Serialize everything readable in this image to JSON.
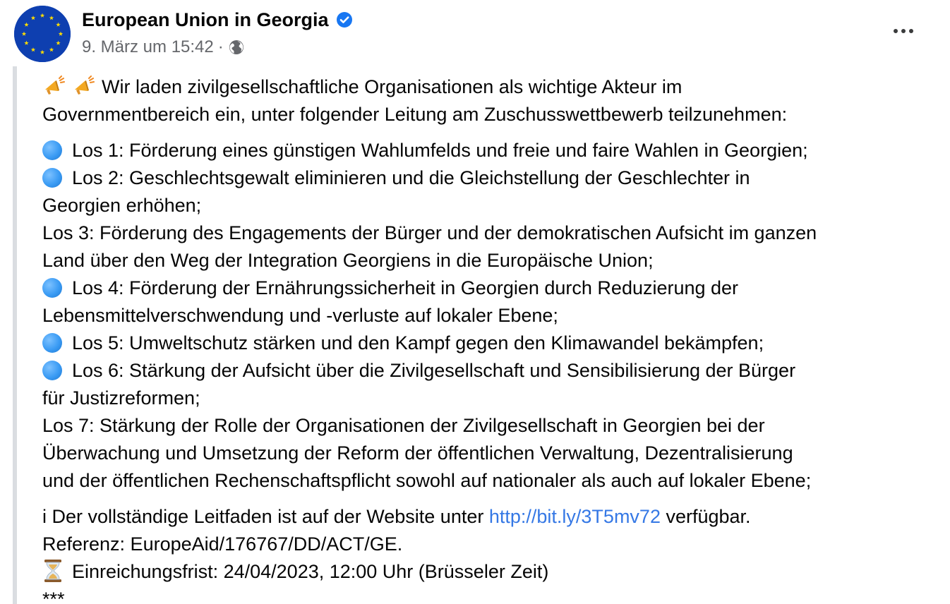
{
  "post": {
    "author": "European Union in Georgia",
    "timestamp": "9. März um 15:42",
    "separator": "·",
    "verified": true,
    "privacy_icon": "globe-icon",
    "more_icon": "more-options-icon",
    "colors": {
      "eu_blue": "#0e3fb0",
      "eu_star": "#ffdd00",
      "verified": "#1877f2",
      "link": "#3578e5",
      "meta_text": "#65676b",
      "quote_bar": "#dadde1"
    }
  },
  "body": {
    "intro": [
      "Wir laden zivilgesellschaftliche Organisationen als wichtige Akteur im",
      "Governmentbereich ein, unter folgender Leitung am Zuschusswettbewerb teilzunehmen:"
    ],
    "lots": {
      "los1": "Los 1: Förderung eines günstigen Wahlumfelds und freie und faire Wahlen in Georgien;",
      "los2_a": "Los 2: Geschlechtsgewalt eliminieren und die Gleichstellung der Geschlechter in",
      "los2_b": "Georgien erhöhen;",
      "los3_a": "Los 3: Förderung des Engagements der Bürger und der demokratischen Aufsicht im ganzen",
      "los3_b": "Land über den Weg der Integration Georgiens in die Europäische Union;",
      "los4_a": "Los 4: Förderung der Ernährungssicherheit in Georgien durch Reduzierung der",
      "los4_b": "Lebensmittelverschwendung und -verluste auf lokaler Ebene;",
      "los5": "Los 5: Umweltschutz stärken und den Kampf gegen den Klimawandel bekämpfen;",
      "los6_a": "Los 6: Stärkung der Aufsicht über die Zivilgesellschaft und Sensibilisierung der Bürger",
      "los6_b": "für Justizreformen;",
      "los7_a": "Los 7: Stärkung der Rolle der Organisationen der Zivilgesellschaft in Georgien bei der",
      "los7_b": "Überwachung und Umsetzung der Reform der öffentlichen Verwaltung, Dezentralisierung",
      "los7_c": "und der öffentlichen Rechenschaftspflicht sowohl auf nationaler als auch auf lokaler Ebene;"
    },
    "info": {
      "guide_prefix": "i Der vollständige Leitfaden ist auf der Website unter ",
      "guide_link": "http://bit.ly/3T5mv72",
      "guide_suffix": " verfügbar.",
      "reference": "Referenz: EuropeAid/176767/DD/ACT/GE.",
      "deadline": "Einreichungsfrist: 24/04/2023, 12:00 Uhr (Brüsseler Zeit)",
      "stars": "***"
    },
    "icons": {
      "megaphone": "megaphone-emoji-icon",
      "blue_circle": "blue-circle-emoji-icon",
      "hourglass": "hourglass-emoji-icon"
    }
  }
}
